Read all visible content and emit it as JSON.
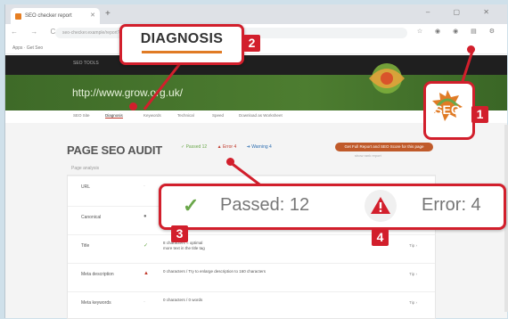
{
  "browser": {
    "tab_title": "SEO checker report",
    "new_tab": "+",
    "window_controls": "– ▢ ✕",
    "nav_buttons": "← → C",
    "url": "seo-checker.example/report?site=http://www.grow.org.uk/",
    "extension_icons": "☆ ◉ ◉ ▤ ⚙",
    "bookmarks": "Apps  ·  Get Seo"
  },
  "site": {
    "top_menu": "SEO TOOLS",
    "url_heading": "http://www.grow.org.uk/",
    "logo_text": "SEO"
  },
  "subnav": {
    "items": [
      "SEO Site",
      "Diagnosis",
      "Keywords",
      "Technical",
      "Speed",
      "Download as Worksheet"
    ]
  },
  "audit": {
    "title": "PAGE SEO AUDIT",
    "chips": [
      "✓ Passed 12",
      "▲ Error 4",
      "➜ Warning 4"
    ],
    "cta": "Get Full Report and SEO Score for this page",
    "cta_sub": "show rank report",
    "page_subtitle": "Page analysis",
    "rows": [
      {
        "label": "URL",
        "status": "·",
        "detail": "",
        "more": ""
      },
      {
        "label": "Canonical",
        "status": "●",
        "detail": "",
        "more": ""
      },
      {
        "label": "Title",
        "status": "✓",
        "detail": "8 characters = optimal\nmore text in the title tag",
        "more": "Tip ›"
      },
      {
        "label": "Meta description",
        "status": "▲",
        "detail": "0 characters / Try to enlarge description to 160 characters",
        "more": "Tip ›"
      },
      {
        "label": "Meta keywords",
        "status": "·",
        "detail": "0 characters / 0 words",
        "more": "Tip ›"
      }
    ]
  },
  "callouts": {
    "diagnosis_label": "DIAGNOSIS",
    "passed_icon": "✓",
    "passed_text": "Passed: 12",
    "error_icon": "▲",
    "error_text": "Error: 4",
    "numbers": [
      "1",
      "2",
      "3",
      "4"
    ]
  },
  "colors": {
    "callout_red": "#d21f2c",
    "hero_green": "#4d7d30",
    "accent_orange": "#e07b25",
    "check_green": "#6aa74a"
  }
}
